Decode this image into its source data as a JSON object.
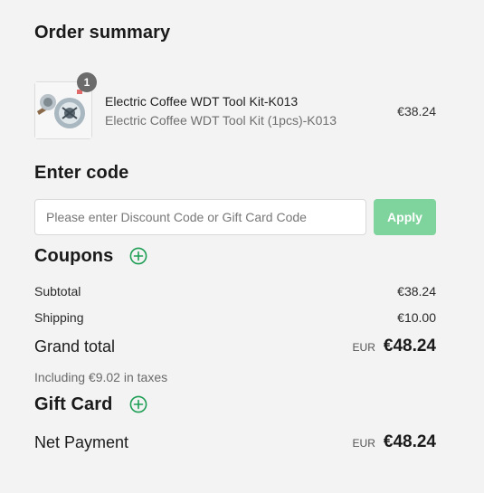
{
  "order_summary": {
    "title": "Order summary"
  },
  "product": {
    "name": "Electric Coffee WDT Tool Kit-K013",
    "variant": "Electric Coffee WDT Tool Kit (1pcs)-K013",
    "price": "€38.24",
    "quantity": "1"
  },
  "code": {
    "title": "Enter code",
    "placeholder": "Please enter Discount Code or Gift Card Code",
    "value": "",
    "apply_label": "Apply"
  },
  "coupons": {
    "title": "Coupons",
    "icon": "plus-circle-icon"
  },
  "totals": {
    "subtotal_label": "Subtotal",
    "subtotal_value": "€38.24",
    "shipping_label": "Shipping",
    "shipping_value": "€10.00",
    "grand_total_label": "Grand total",
    "grand_total_currency": "EUR",
    "grand_total_value": "€48.24",
    "tax_note": "Including €9.02 in taxes"
  },
  "gift_card": {
    "title": "Gift Card",
    "icon": "plus-circle-icon"
  },
  "net_payment": {
    "label": "Net Payment",
    "currency": "EUR",
    "value": "€48.24"
  },
  "colors": {
    "accent_green": "#1e9e55",
    "apply_button_disabled": "#7fd39c",
    "background": "#f3f3f3"
  }
}
